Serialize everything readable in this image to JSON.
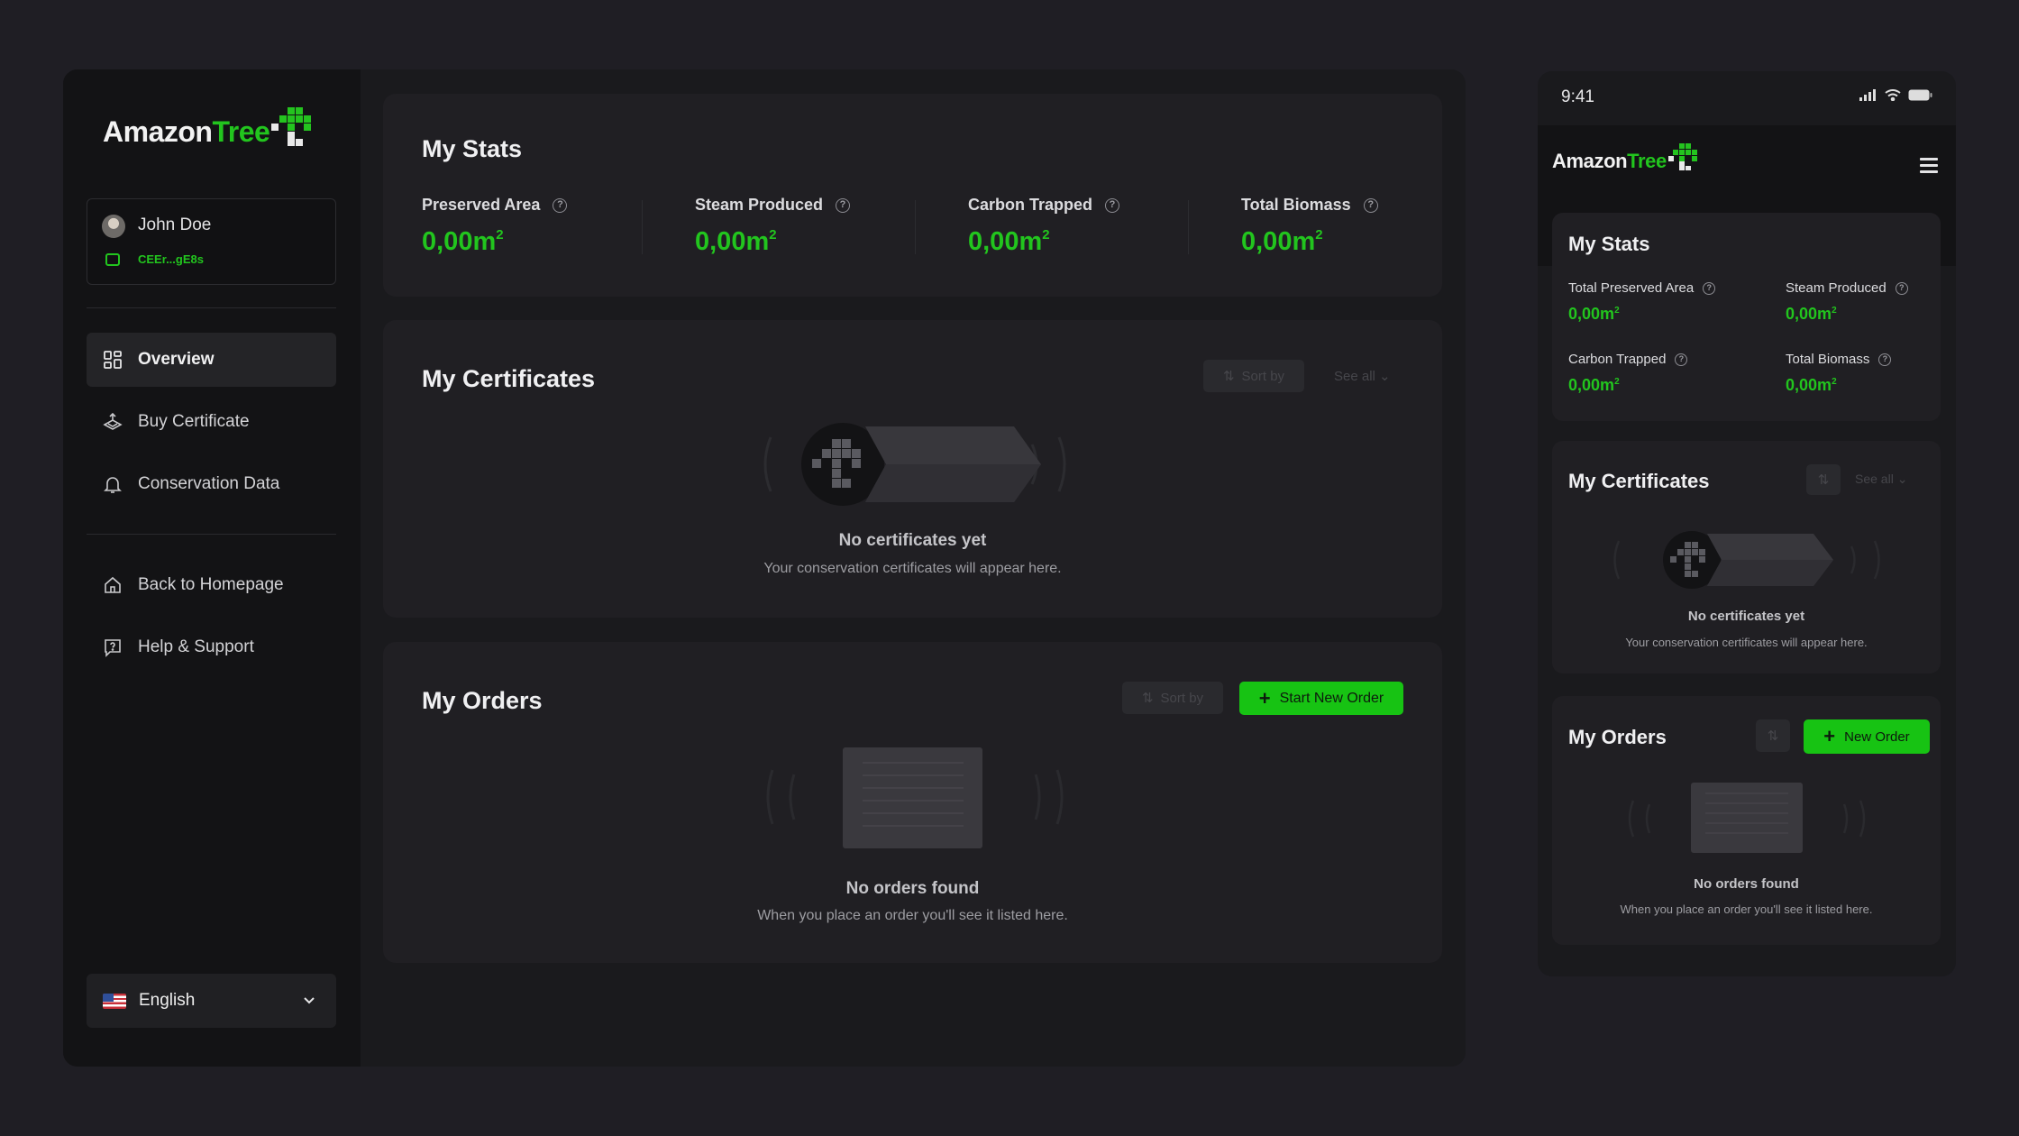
{
  "brand": {
    "part1": "Amazon",
    "part2": "Tree"
  },
  "user": {
    "name": "John Doe",
    "wallet": "CEEr...gE8s"
  },
  "nav": {
    "main": [
      {
        "label": "Overview",
        "icon": "grid-icon",
        "active": true
      },
      {
        "label": "Buy Certificate",
        "icon": "certificate-icon",
        "active": false
      },
      {
        "label": "Conservation Data",
        "icon": "bell-icon",
        "active": false
      }
    ],
    "secondary": [
      {
        "label": "Back to Homepage",
        "icon": "home-icon"
      },
      {
        "label": "Help & Support",
        "icon": "help-chat-icon"
      }
    ]
  },
  "language": {
    "label": "English",
    "flag": "us-flag-icon"
  },
  "stats": {
    "title": "My Stats",
    "unit": "m",
    "items": [
      {
        "label": "Preserved Area",
        "value": "0,00"
      },
      {
        "label": "Steam Produced",
        "value": "0,00"
      },
      {
        "label": "Carbon Trapped",
        "value": "0,00"
      },
      {
        "label": "Total Biomass",
        "value": "0,00"
      }
    ]
  },
  "certificates": {
    "title": "My Certificates",
    "sort_label": "Sort by",
    "see_all": "See all",
    "empty_title": "No certificates yet",
    "empty_sub": "Your conservation certificates will appear here."
  },
  "orders": {
    "title": "My Orders",
    "sort_label": "Sort by",
    "new_order": "Start New Order",
    "empty_title": "No orders found",
    "empty_sub": "When you place an order you'll see it listed here."
  },
  "mobile": {
    "time": "9:41",
    "stats": {
      "title": "My Stats",
      "items": [
        {
          "label": "Total Preserved Area",
          "value": "0,00"
        },
        {
          "label": "Steam Produced",
          "value": "0,00"
        },
        {
          "label": "Carbon Trapped",
          "value": "0,00"
        },
        {
          "label": "Total Biomass",
          "value": "0,00"
        }
      ]
    },
    "certificates": {
      "title": "My Certificates",
      "see_all": "See all",
      "empty_title": "No certificates yet",
      "empty_sub": "Your conservation certificates will appear here."
    },
    "orders": {
      "title": "My Orders",
      "new_order": "New Order",
      "empty_title": "No orders found",
      "empty_sub": "When you place an order you'll see it listed here."
    }
  },
  "colors": {
    "accent": "#22c51e",
    "background": "#1f1e24",
    "sidebar": "#131315",
    "card": "#201f23"
  }
}
